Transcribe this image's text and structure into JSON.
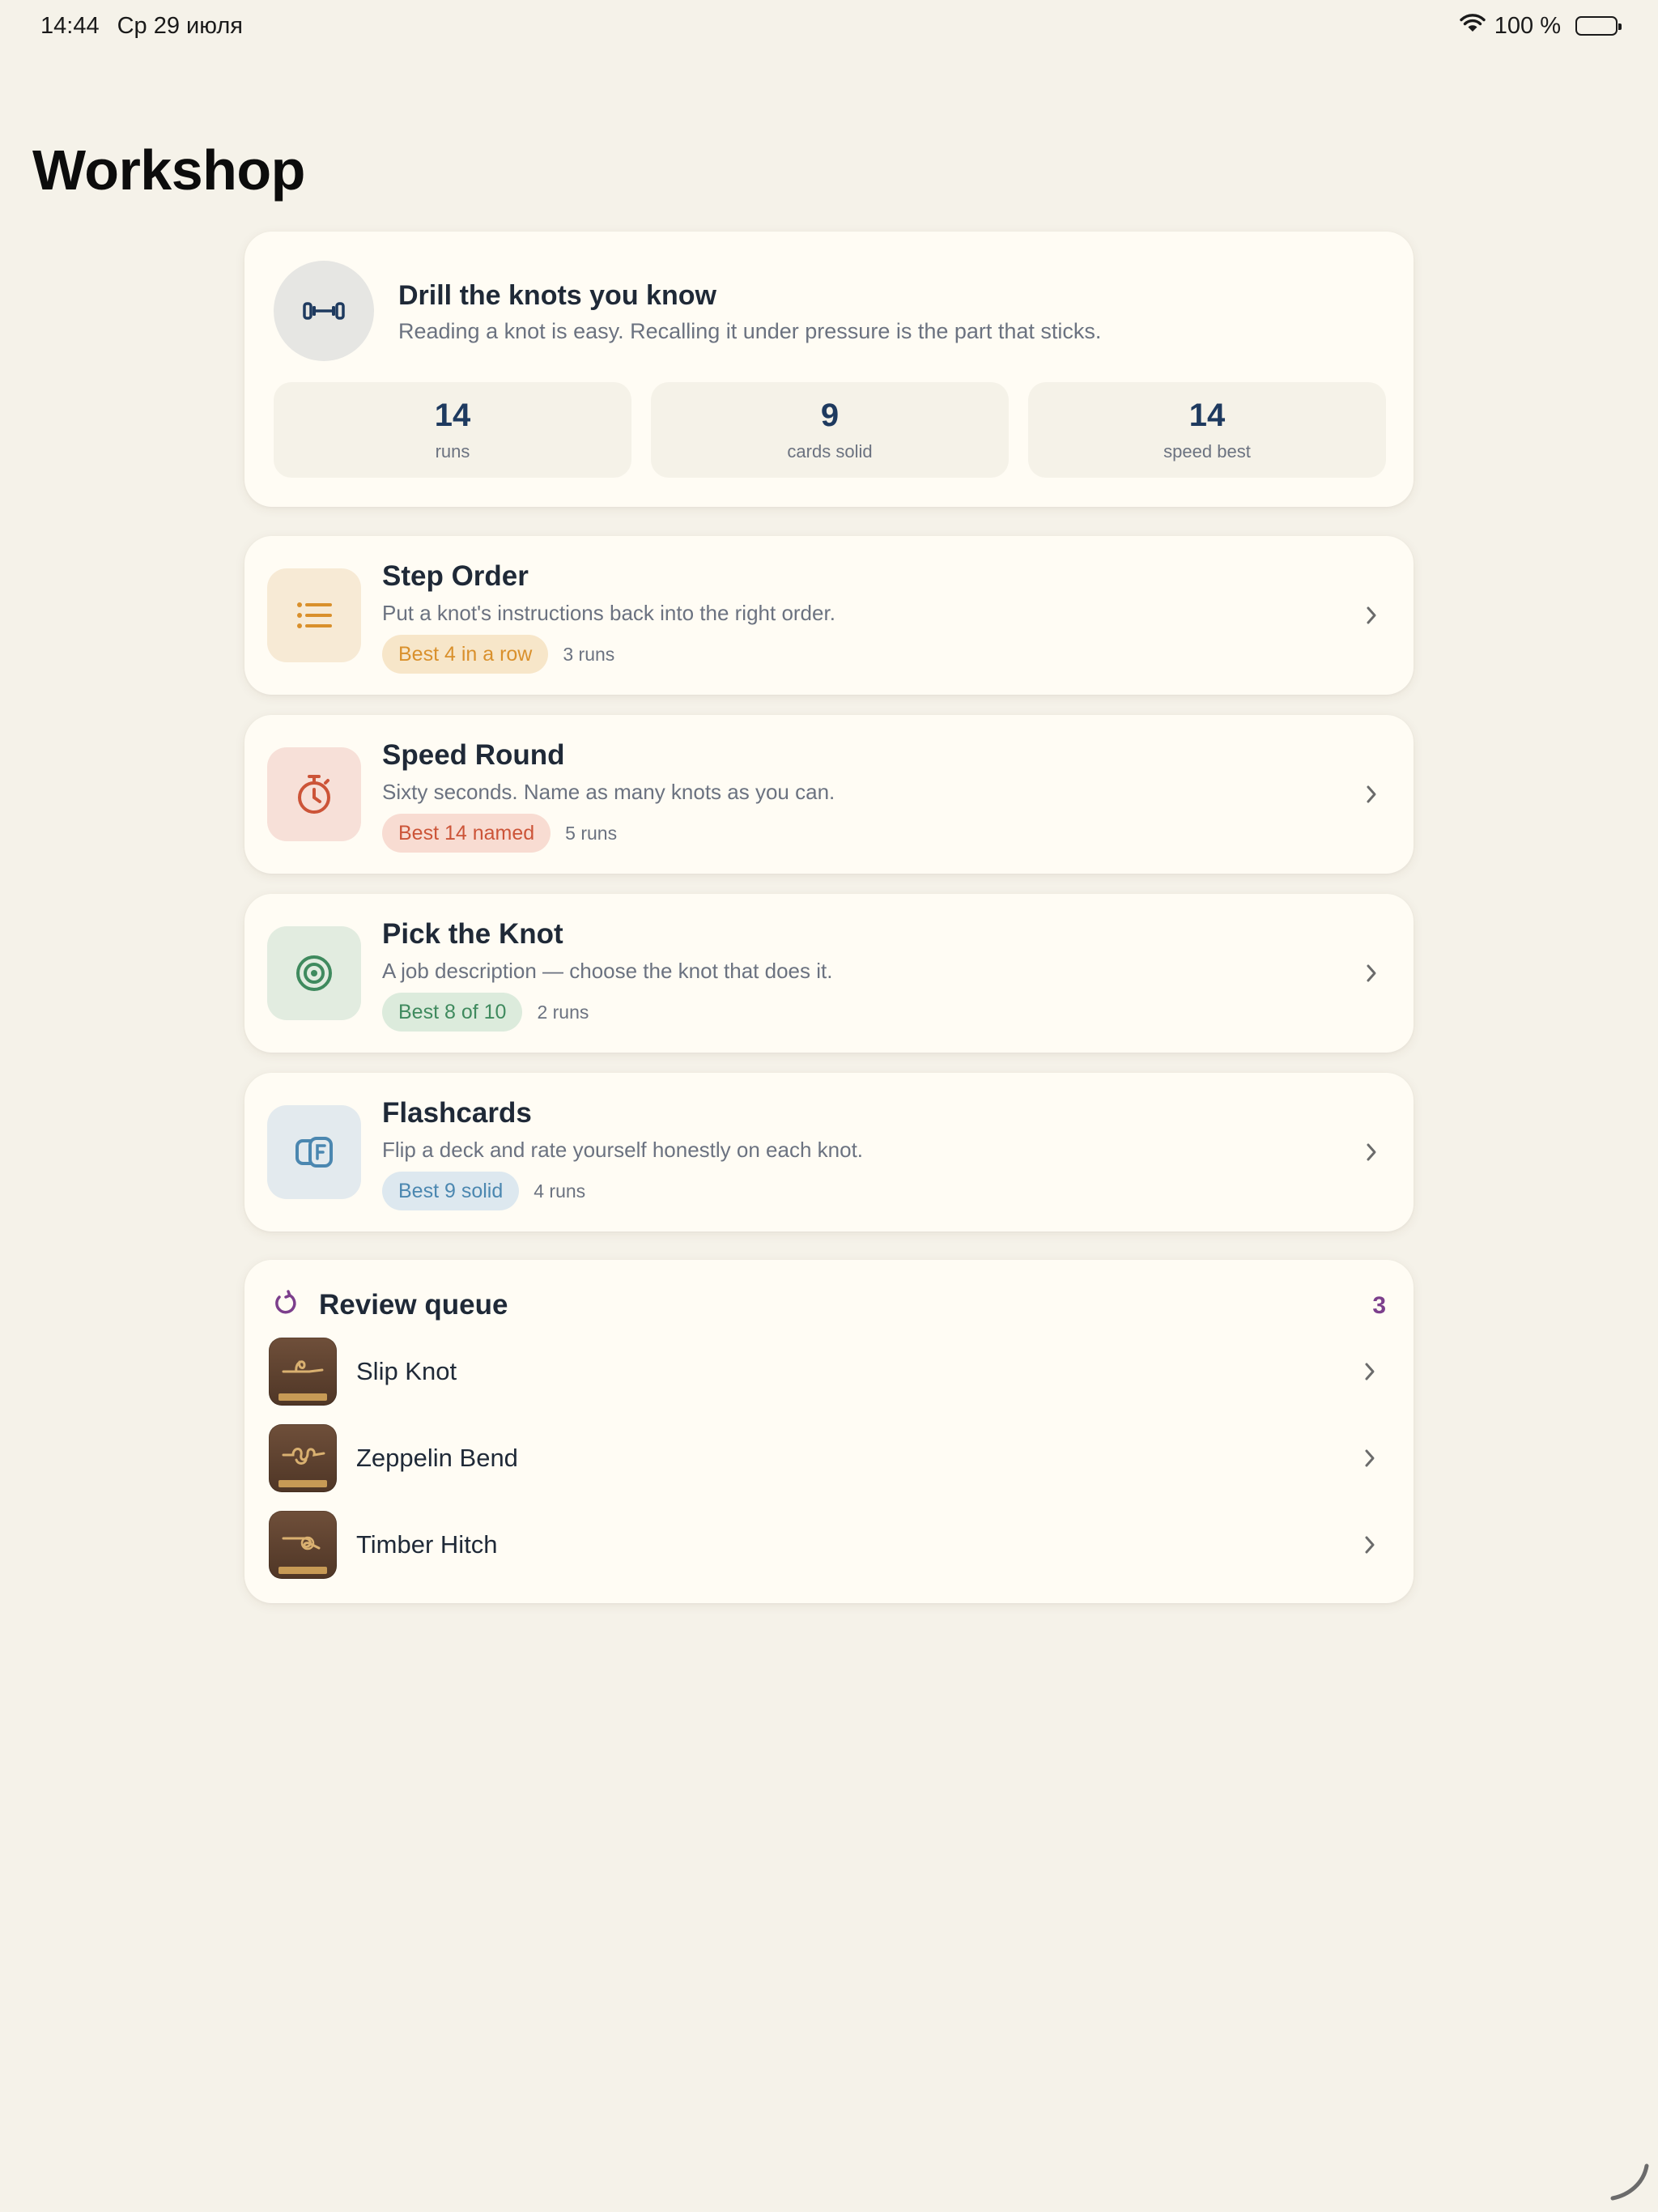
{
  "status_bar": {
    "time": "14:44",
    "date": "Ср 29 июля",
    "battery": "100 %",
    "icons": [
      "wifi-icon",
      "battery-icon"
    ]
  },
  "page": {
    "title": "Workshop"
  },
  "hero": {
    "icon": "dumbbell-icon",
    "title": "Drill the knots you know",
    "subtitle": "Reading a knot is easy. Recalling it under pressure is the part that sticks.",
    "stats": [
      {
        "value": "14",
        "label": "runs"
      },
      {
        "value": "9",
        "label": "cards solid"
      },
      {
        "value": "14",
        "label": "speed best"
      }
    ]
  },
  "activities": [
    {
      "icon": "list-icon",
      "title": "Step Order",
      "description": "Put a knot's instructions back into the right order.",
      "best": "Best 4 in a row",
      "runs": "3 runs",
      "colors": {
        "icon_bg": "#f7ead5",
        "accent": "#d9902c",
        "badge_bg": "#f7e6c9"
      }
    },
    {
      "icon": "stopwatch-icon",
      "title": "Speed Round",
      "description": "Sixty seconds. Name as many knots as you can.",
      "best": "Best 14 named",
      "runs": "5 runs",
      "colors": {
        "icon_bg": "#f7e0d8",
        "accent": "#cc5438",
        "badge_bg": "#f8dcd2"
      }
    },
    {
      "icon": "target-icon",
      "title": "Pick the Knot",
      "description": "A job description — choose the knot that does it.",
      "best": "Best 8 of 10",
      "runs": "2 runs",
      "colors": {
        "icon_bg": "#e2ece0",
        "accent": "#3f8a5e",
        "badge_bg": "#dcebdc"
      }
    },
    {
      "icon": "flashcards-icon",
      "title": "Flashcards",
      "description": "Flip a deck and rate yourself honestly on each knot.",
      "best": "Best 9 solid",
      "runs": "4 runs",
      "colors": {
        "icon_bg": "#e3eaee",
        "accent": "#4b87b0",
        "badge_bg": "#dde8ef"
      }
    }
  ],
  "review_queue": {
    "icon": "refresh-icon",
    "title": "Review queue",
    "count": "3",
    "items": [
      {
        "name": "Slip Knot",
        "thumb": "knot-thumbnail"
      },
      {
        "name": "Zeppelin Bend",
        "thumb": "knot-thumbnail"
      },
      {
        "name": "Timber Hitch",
        "thumb": "knot-thumbnail"
      }
    ],
    "colors": {
      "accent": "#7c3f8c"
    }
  }
}
